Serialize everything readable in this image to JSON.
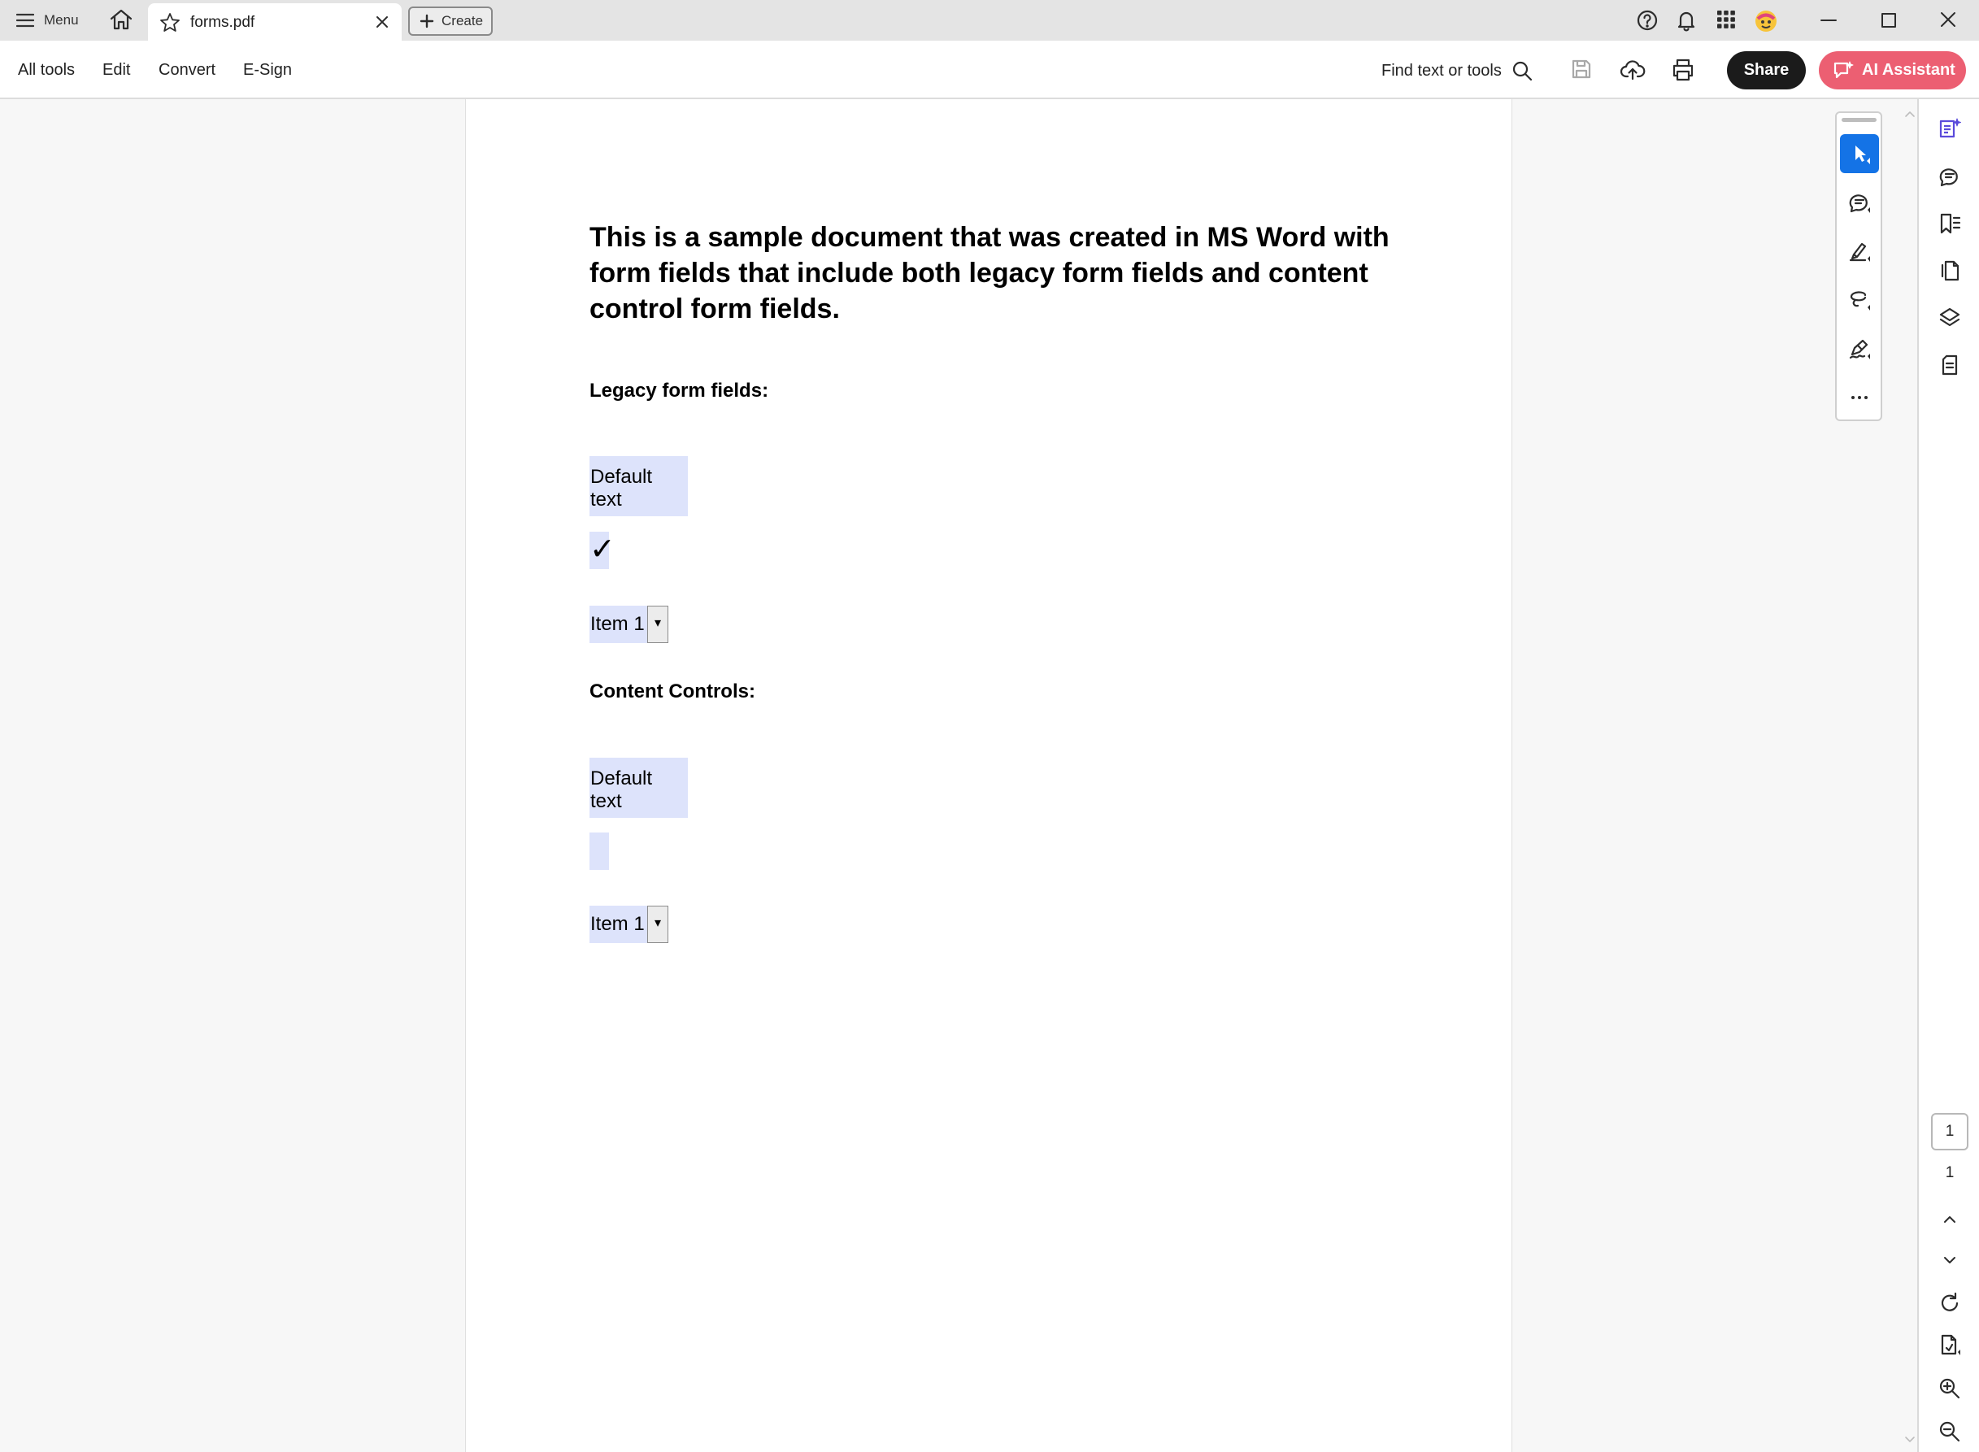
{
  "titlebar": {
    "menu_label": "Menu",
    "tab_title": "forms.pdf",
    "create_label": "Create"
  },
  "toolbar": {
    "nav": [
      "All tools",
      "Edit",
      "Convert",
      "E-Sign"
    ],
    "find_label": "Find text or tools",
    "share_label": "Share",
    "ai_label": "AI Assistant"
  },
  "document": {
    "heading": "This is a sample document that was created in MS Word with form fields that include both legacy form fields and content control form fields.",
    "legacy": {
      "title": "Legacy form fields:",
      "text_field_value": "Default text",
      "checkbox_mark": "✓",
      "dropdown_value": "Item 1",
      "dropdown_arrow": "▾"
    },
    "content_controls": {
      "title": "Content Controls:",
      "text_field_value": "Default text",
      "dropdown_value": "Item 1",
      "dropdown_arrow": "▾"
    }
  },
  "quick_tools": [
    "select-tool",
    "comment-tool",
    "highlight-tool",
    "draw-tool",
    "sign-tool",
    "more-tools"
  ],
  "pagination": {
    "current_page": "1",
    "total_pages": "1"
  },
  "colors": {
    "share_bg": "#1b1b1b",
    "ai_bg": "#ec5f72",
    "active_tool": "#1473e6",
    "form_field_highlight": "#dde3fb",
    "panel_accent": "#5b4bdb"
  }
}
